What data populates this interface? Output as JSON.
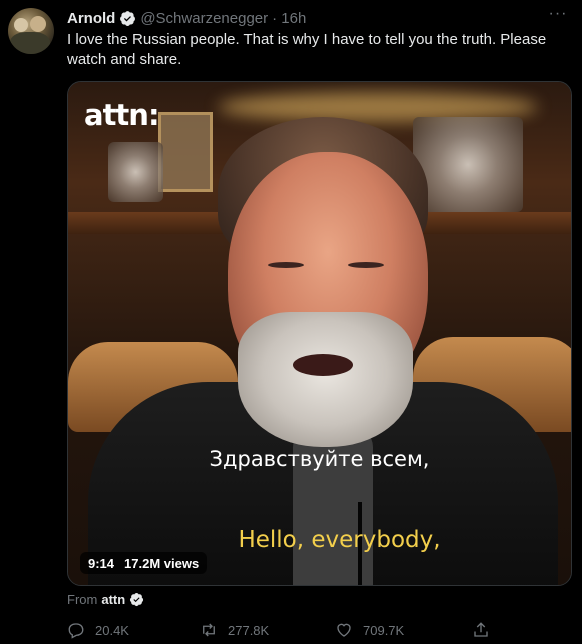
{
  "tweet": {
    "name": "Arnold",
    "handle": "@Schwarzenegger",
    "time": "· 16h",
    "text": "I love the Russian people. That is why I have to tell you the truth. Please watch and share.",
    "more_label": "···"
  },
  "media": {
    "logo_text": "attn:",
    "caption_ru": "Здравствуйте всем,",
    "caption_en": "Hello, everybody,",
    "duration": "9:14",
    "views": "17.2M views"
  },
  "source": {
    "prefix": "From",
    "name": "attn"
  },
  "actions": {
    "replies": "20.4K",
    "retweets": "277.8K",
    "likes": "709.7K"
  },
  "colors": {
    "background": "#000000",
    "text": "#e7e9ea",
    "muted": "#71767b",
    "verified_blue": "#1d9bf0",
    "caption_yellow": "#f3cf4c"
  },
  "icons": [
    "verified-badge-icon",
    "more-icon",
    "reply-icon",
    "retweet-icon",
    "like-icon",
    "share-icon"
  ]
}
